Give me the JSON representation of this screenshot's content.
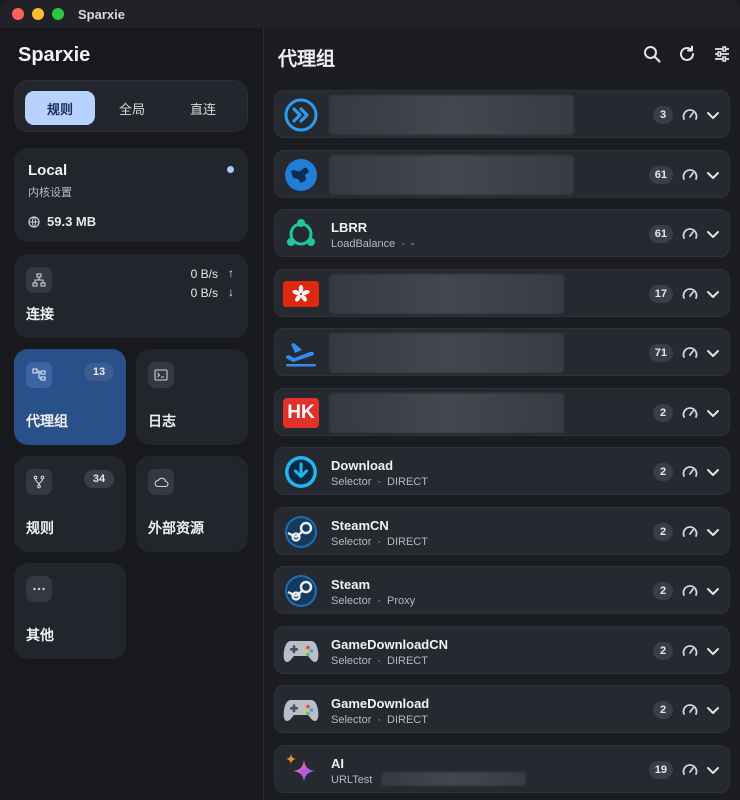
{
  "window": {
    "title": "Sparxie"
  },
  "sidebar": {
    "app_title": "Sparxie",
    "modes": [
      {
        "label": "规则",
        "active": true
      },
      {
        "label": "全局",
        "active": false
      },
      {
        "label": "直连",
        "active": false
      }
    ],
    "core": {
      "title": "Local",
      "subtitle": "内核设置",
      "memory": "59.3 MB"
    },
    "connections": {
      "label": "连接",
      "upload": "0 B/s",
      "download": "0 B/s"
    },
    "tiles": [
      {
        "label": "代理组",
        "badge": "13",
        "icon": "proxy-group-icon",
        "active": true
      },
      {
        "label": "日志",
        "badge": "",
        "icon": "terminal-icon",
        "active": false
      },
      {
        "label": "规则",
        "badge": "34",
        "icon": "fork-icon",
        "active": false
      },
      {
        "label": "外部资源",
        "badge": "",
        "icon": "cloud-icon",
        "active": false
      },
      {
        "label": "其他",
        "badge": "",
        "icon": "more-icon",
        "active": false
      }
    ]
  },
  "main": {
    "title": "代理组",
    "groups": [
      {
        "name": "",
        "type": "",
        "current": "",
        "count": "3",
        "icon": "fast-forward-icon",
        "redacted": true
      },
      {
        "name": "",
        "type": "",
        "current": "",
        "count": "61",
        "icon": "globe-icon",
        "redacted": true
      },
      {
        "name": "LBRR",
        "type": "LoadBalance",
        "current": "-",
        "count": "61",
        "icon": "share-icon",
        "redacted": false
      },
      {
        "name": "",
        "type": "",
        "current": "",
        "count": "17",
        "icon": "hong-kong-flag-icon",
        "redacted": true
      },
      {
        "name": "",
        "type": "",
        "current": "",
        "count": "71",
        "icon": "airplane-icon",
        "redacted": true
      },
      {
        "name": "",
        "type": "",
        "current": "",
        "count": "2",
        "icon": "hk-icon",
        "redacted": true,
        "badge_text": "HK"
      },
      {
        "name": "Download",
        "type": "Selector",
        "current": "DIRECT",
        "count": "2",
        "icon": "download-icon",
        "redacted": false
      },
      {
        "name": "SteamCN",
        "type": "Selector",
        "current": "DIRECT",
        "count": "2",
        "icon": "steam-icon",
        "redacted": false
      },
      {
        "name": "Steam",
        "type": "Selector",
        "current": "Proxy",
        "count": "2",
        "icon": "steam-icon",
        "redacted": false
      },
      {
        "name": "GameDownloadCN",
        "type": "Selector",
        "current": "DIRECT",
        "count": "2",
        "icon": "gamepad-icon",
        "redacted": false
      },
      {
        "name": "GameDownload",
        "type": "Selector",
        "current": "DIRECT",
        "count": "2",
        "icon": "gamepad-icon",
        "redacted": false
      },
      {
        "name": "AI",
        "type": "URLTest",
        "current": "",
        "count": "19",
        "icon": "sparkle-icon",
        "redacted": false
      }
    ]
  },
  "colors": {
    "accent": "#b7d2ff",
    "active_tile": "#2a5089",
    "badge_bg": "#3a3e48"
  }
}
